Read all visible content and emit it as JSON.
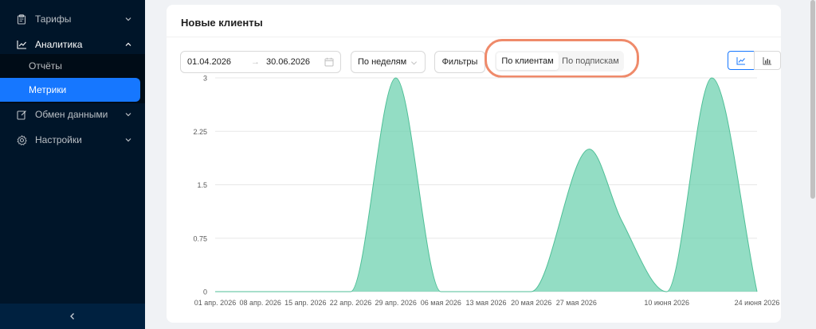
{
  "sidebar": {
    "items": [
      {
        "label": "Тарифы",
        "icon": "clipboard-icon"
      },
      {
        "label": "Аналитика",
        "icon": "line-chart-icon",
        "open": true
      },
      {
        "label": "Обмен данными",
        "icon": "edit-icon"
      },
      {
        "label": "Настройки",
        "icon": "gear-icon"
      }
    ],
    "subitems": [
      {
        "label": "Отчёты"
      },
      {
        "label": "Метрики",
        "active": true
      }
    ],
    "collapse_icon": "chevron-left-icon",
    "colors": {
      "bg": "#001529",
      "active": "#1677ff"
    }
  },
  "card": {
    "title": "Новые клиенты"
  },
  "filters": {
    "date_from": "01.04.2026",
    "date_to": "30.06.2026",
    "arrow": "→",
    "period": "По неделям",
    "filters_label": "Фильтры",
    "segment_options": [
      "По клиентам",
      "По подпискам"
    ],
    "segment_selected": "По клиентам"
  },
  "chart_data": {
    "type": "area",
    "title": "",
    "xlabel": "",
    "ylabel": "",
    "ylim": [
      0,
      3
    ],
    "yticks": [
      "0",
      "0.75",
      "1.5",
      "2.25",
      "3"
    ],
    "xticks": [
      "01 апр. 2026",
      "08 апр. 2026",
      "15 апр. 2026",
      "22 апр. 2026",
      "29 апр. 2026",
      "06 мая 2026",
      "13 мая 2026",
      "20 мая 2026",
      "27 мая 2026",
      "10 июня 2026",
      "24 июня 2026"
    ],
    "series": [
      {
        "color": "#6fd1b0",
        "x": [
          "2026-04-01",
          "2026-04-22",
          "2026-04-29",
          "2026-05-06",
          "2026-05-20",
          "2026-05-29",
          "2026-06-03",
          "2026-06-10",
          "2026-06-17",
          "2026-06-24"
        ],
        "values": [
          0,
          0,
          3,
          0,
          0,
          2,
          1,
          0,
          3,
          0
        ]
      }
    ],
    "grid": true
  }
}
